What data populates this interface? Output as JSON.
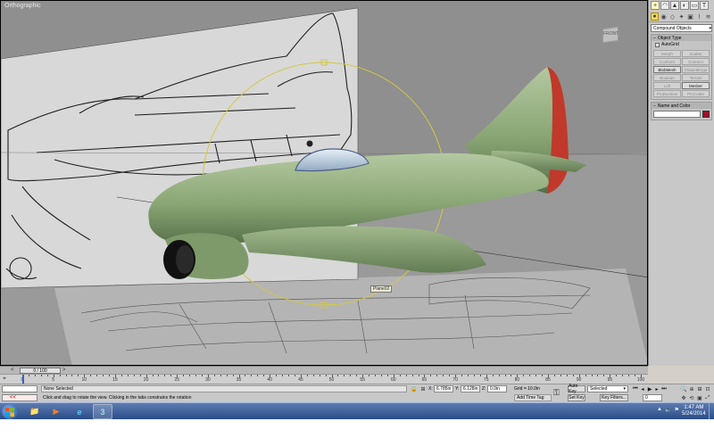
{
  "viewport": {
    "label": "Orthographic",
    "object_label": "Plane02",
    "viewcube_label": "FRONT"
  },
  "command_panel": {
    "tabs": [
      "+",
      "◠",
      "▲",
      "◐",
      "▭",
      "T"
    ],
    "icons": [
      "●",
      "◉",
      "◇",
      "✦",
      "▣",
      "⌇",
      "≋"
    ],
    "category_dropdown": "Compound Objects",
    "object_type": {
      "title": "Object Type",
      "autogrid_label": "AutoGrid",
      "buttons": [
        {
          "label": "Morph",
          "enabled": false
        },
        {
          "label": "Scatter",
          "enabled": false
        },
        {
          "label": "Conform",
          "enabled": false
        },
        {
          "label": "Connect",
          "enabled": false
        },
        {
          "label": "BlobMesh",
          "enabled": true
        },
        {
          "label": "ShapeMerge",
          "enabled": false
        },
        {
          "label": "Boolean",
          "enabled": false
        },
        {
          "label": "Terrain",
          "enabled": false
        },
        {
          "label": "Loft",
          "enabled": false
        },
        {
          "label": "Mesher",
          "enabled": true
        },
        {
          "label": "ProBoolean",
          "enabled": false
        },
        {
          "label": "ProCutter",
          "enabled": false
        }
      ]
    },
    "name_color": {
      "title": "Name and Color",
      "swatch_color": "#a0102a"
    }
  },
  "timeline": {
    "slider_text": "0 / 100",
    "prev_arrow": "<",
    "next_arrow": ">",
    "ticks": [
      0,
      5,
      10,
      15,
      20,
      25,
      30,
      35,
      40,
      45,
      50,
      55,
      60,
      65,
      70,
      75,
      80,
      85,
      90,
      95,
      100
    ],
    "current_frame": 0
  },
  "status": {
    "maxscript_arrow": "<<",
    "selection": "None Selected",
    "prompt": "Click and drag to rotate the view.  Clicking in the tabs constrains the rotation",
    "x_label": "X:",
    "x_value": "6.785in",
    "y_label": "Y:",
    "y_value": "6.128in",
    "z_label": "Z:",
    "z_value": "0.0in",
    "grid": "Grid = 10.0in",
    "add_time_tag": "Add Time Tag",
    "auto_key": "Auto Key",
    "set_key": "Set Key",
    "selected_dropdown": "Selected",
    "key_filters": "Key Filters...",
    "frame_value": "0",
    "playback": [
      "⏮",
      "◂",
      "▶",
      "▸",
      "⏭"
    ],
    "nav_icons": [
      "🔍",
      "⊕",
      "⊞",
      "⊡",
      "✥",
      "⟲",
      "▣",
      "⤢"
    ]
  },
  "taskbar": {
    "apps": [
      {
        "name": "explorer",
        "glyph": "📁"
      },
      {
        "name": "media",
        "glyph": "▶"
      },
      {
        "name": "ie",
        "glyph": "e"
      },
      {
        "name": "3dsmax",
        "glyph": "3"
      }
    ],
    "tray": [
      "▲",
      "🔈",
      "⚑"
    ],
    "time": "1:47 AM",
    "date": "5/24/2014"
  }
}
